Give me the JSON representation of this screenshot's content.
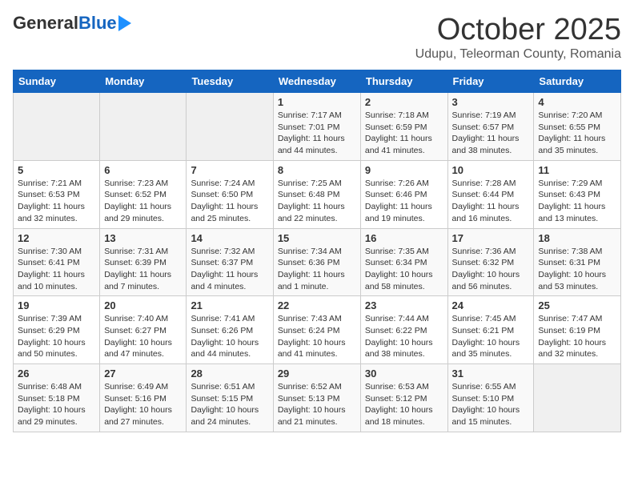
{
  "header": {
    "logo_general": "General",
    "logo_blue": "Blue",
    "month": "October 2025",
    "location": "Udupu, Teleorman County, Romania"
  },
  "columns": [
    "Sunday",
    "Monday",
    "Tuesday",
    "Wednesday",
    "Thursday",
    "Friday",
    "Saturday"
  ],
  "weeks": [
    [
      {
        "day": "",
        "info": ""
      },
      {
        "day": "",
        "info": ""
      },
      {
        "day": "",
        "info": ""
      },
      {
        "day": "1",
        "info": "Sunrise: 7:17 AM\nSunset: 7:01 PM\nDaylight: 11 hours and 44 minutes."
      },
      {
        "day": "2",
        "info": "Sunrise: 7:18 AM\nSunset: 6:59 PM\nDaylight: 11 hours and 41 minutes."
      },
      {
        "day": "3",
        "info": "Sunrise: 7:19 AM\nSunset: 6:57 PM\nDaylight: 11 hours and 38 minutes."
      },
      {
        "day": "4",
        "info": "Sunrise: 7:20 AM\nSunset: 6:55 PM\nDaylight: 11 hours and 35 minutes."
      }
    ],
    [
      {
        "day": "5",
        "info": "Sunrise: 7:21 AM\nSunset: 6:53 PM\nDaylight: 11 hours and 32 minutes."
      },
      {
        "day": "6",
        "info": "Sunrise: 7:23 AM\nSunset: 6:52 PM\nDaylight: 11 hours and 29 minutes."
      },
      {
        "day": "7",
        "info": "Sunrise: 7:24 AM\nSunset: 6:50 PM\nDaylight: 11 hours and 25 minutes."
      },
      {
        "day": "8",
        "info": "Sunrise: 7:25 AM\nSunset: 6:48 PM\nDaylight: 11 hours and 22 minutes."
      },
      {
        "day": "9",
        "info": "Sunrise: 7:26 AM\nSunset: 6:46 PM\nDaylight: 11 hours and 19 minutes."
      },
      {
        "day": "10",
        "info": "Sunrise: 7:28 AM\nSunset: 6:44 PM\nDaylight: 11 hours and 16 minutes."
      },
      {
        "day": "11",
        "info": "Sunrise: 7:29 AM\nSunset: 6:43 PM\nDaylight: 11 hours and 13 minutes."
      }
    ],
    [
      {
        "day": "12",
        "info": "Sunrise: 7:30 AM\nSunset: 6:41 PM\nDaylight: 11 hours and 10 minutes."
      },
      {
        "day": "13",
        "info": "Sunrise: 7:31 AM\nSunset: 6:39 PM\nDaylight: 11 hours and 7 minutes."
      },
      {
        "day": "14",
        "info": "Sunrise: 7:32 AM\nSunset: 6:37 PM\nDaylight: 11 hours and 4 minutes."
      },
      {
        "day": "15",
        "info": "Sunrise: 7:34 AM\nSunset: 6:36 PM\nDaylight: 11 hours and 1 minute."
      },
      {
        "day": "16",
        "info": "Sunrise: 7:35 AM\nSunset: 6:34 PM\nDaylight: 10 hours and 58 minutes."
      },
      {
        "day": "17",
        "info": "Sunrise: 7:36 AM\nSunset: 6:32 PM\nDaylight: 10 hours and 56 minutes."
      },
      {
        "day": "18",
        "info": "Sunrise: 7:38 AM\nSunset: 6:31 PM\nDaylight: 10 hours and 53 minutes."
      }
    ],
    [
      {
        "day": "19",
        "info": "Sunrise: 7:39 AM\nSunset: 6:29 PM\nDaylight: 10 hours and 50 minutes."
      },
      {
        "day": "20",
        "info": "Sunrise: 7:40 AM\nSunset: 6:27 PM\nDaylight: 10 hours and 47 minutes."
      },
      {
        "day": "21",
        "info": "Sunrise: 7:41 AM\nSunset: 6:26 PM\nDaylight: 10 hours and 44 minutes."
      },
      {
        "day": "22",
        "info": "Sunrise: 7:43 AM\nSunset: 6:24 PM\nDaylight: 10 hours and 41 minutes."
      },
      {
        "day": "23",
        "info": "Sunrise: 7:44 AM\nSunset: 6:22 PM\nDaylight: 10 hours and 38 minutes."
      },
      {
        "day": "24",
        "info": "Sunrise: 7:45 AM\nSunset: 6:21 PM\nDaylight: 10 hours and 35 minutes."
      },
      {
        "day": "25",
        "info": "Sunrise: 7:47 AM\nSunset: 6:19 PM\nDaylight: 10 hours and 32 minutes."
      }
    ],
    [
      {
        "day": "26",
        "info": "Sunrise: 6:48 AM\nSunset: 5:18 PM\nDaylight: 10 hours and 29 minutes."
      },
      {
        "day": "27",
        "info": "Sunrise: 6:49 AM\nSunset: 5:16 PM\nDaylight: 10 hours and 27 minutes."
      },
      {
        "day": "28",
        "info": "Sunrise: 6:51 AM\nSunset: 5:15 PM\nDaylight: 10 hours and 24 minutes."
      },
      {
        "day": "29",
        "info": "Sunrise: 6:52 AM\nSunset: 5:13 PM\nDaylight: 10 hours and 21 minutes."
      },
      {
        "day": "30",
        "info": "Sunrise: 6:53 AM\nSunset: 5:12 PM\nDaylight: 10 hours and 18 minutes."
      },
      {
        "day": "31",
        "info": "Sunrise: 6:55 AM\nSunset: 5:10 PM\nDaylight: 10 hours and 15 minutes."
      },
      {
        "day": "",
        "info": ""
      }
    ]
  ]
}
